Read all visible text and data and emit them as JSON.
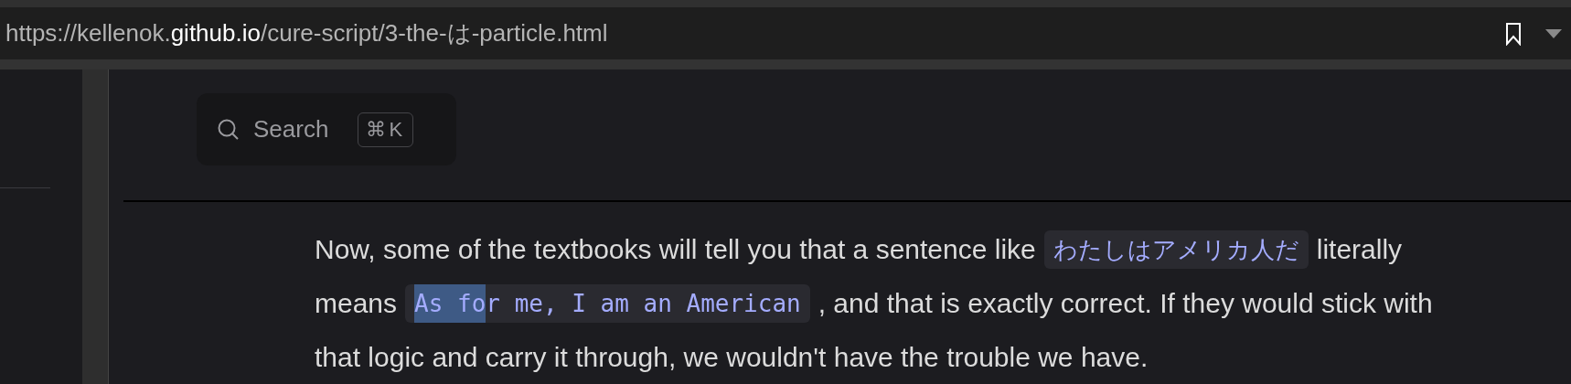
{
  "address_bar": {
    "url_prefix": "https://kellenok.",
    "url_domain": "github.io",
    "url_path": "/cure-script/3-the-は-particle.html"
  },
  "search": {
    "placeholder": "Search",
    "shortcut": "⌘K"
  },
  "paragraph_lines": [
    [
      {
        "kind": "text",
        "text": "Now, some of the textbooks will tell you that a sentence like"
      },
      {
        "kind": "code",
        "rest": "わたしはアメリカ人だ"
      },
      {
        "kind": "text",
        "text": "literally"
      }
    ],
    [
      {
        "kind": "text",
        "text": "means"
      },
      {
        "kind": "code",
        "selected_part": "As fo",
        "rest": "r me, I am an American"
      },
      {
        "kind": "text",
        "text": ", and that is exactly correct. If they would stick with"
      }
    ],
    [
      {
        "kind": "text",
        "text": "that logic and carry it through, we wouldn't have the trouble we have."
      }
    ]
  ]
}
